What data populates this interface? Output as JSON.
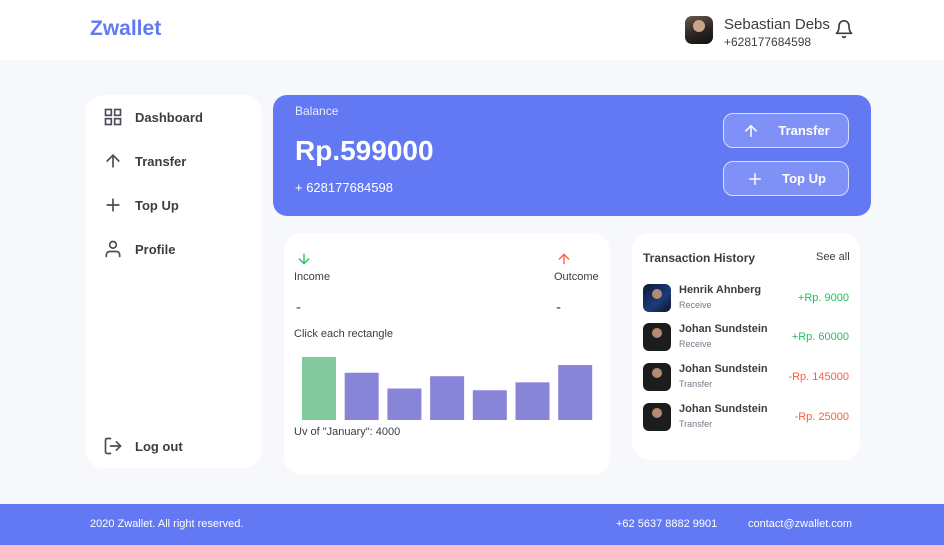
{
  "header": {
    "brand": "Zwallet",
    "user_name": "Sebastian Debs",
    "user_phone": "+628177684598"
  },
  "sidebar": {
    "items": [
      {
        "label": "Dashboard",
        "icon": "grid-icon"
      },
      {
        "label": "Transfer",
        "icon": "arrow-up-icon"
      },
      {
        "label": "Top Up",
        "icon": "plus-icon"
      },
      {
        "label": "Profile",
        "icon": "user-icon"
      }
    ],
    "logout_label": "Log out"
  },
  "balance": {
    "label": "Balance",
    "amount": "Rp.599000",
    "phone": "+ 628177684598",
    "transfer_label": "Transfer",
    "topup_label": "Top Up"
  },
  "stats": {
    "income_label": "Income",
    "income_value": "-",
    "outcome_label": "Outcome",
    "outcome_value": "-",
    "hint": "Click each rectangle",
    "caption": "Uv of \"January\": 4000"
  },
  "chart_data": {
    "type": "bar",
    "categories": [
      "",
      "",
      "",
      "",
      "",
      "",
      ""
    ],
    "values": [
      4000,
      3000,
      2000,
      2780,
      1890,
      2390,
      3490
    ],
    "active_index": 0,
    "colors": {
      "active": "#82ca9d",
      "default": "#8884d8"
    },
    "ylim": [
      0,
      4000
    ],
    "title": "",
    "xlabel": "",
    "ylabel": ""
  },
  "history": {
    "title": "Transaction History",
    "see_all": "See all",
    "transactions": [
      {
        "name": "Henrik Ahnberg",
        "type": "Receive",
        "amount": "+Rp. 9000",
        "color": "#1ec15f",
        "avatar": "blue"
      },
      {
        "name": "Johan Sundstein",
        "type": "Receive",
        "amount": "+Rp. 60000",
        "color": "#1ec15f",
        "avatar": "dark"
      },
      {
        "name": "Johan Sundstein",
        "type": "Transfer",
        "amount": "-Rp. 145000",
        "color": "#ff5b37",
        "avatar": "dark"
      },
      {
        "name": "Johan Sundstein",
        "type": "Transfer",
        "amount": "-Rp. 25000",
        "color": "#ff5b37",
        "avatar": "dark"
      }
    ]
  },
  "footer": {
    "copyright": "2020 Zwallet. All right reserved.",
    "phone": "+62 5637 8882 9901",
    "email": "contact@zwallet.com"
  },
  "colors": {
    "primary": "#6379f4",
    "income": "#1ec15f",
    "outcome": "#ff5b37"
  }
}
